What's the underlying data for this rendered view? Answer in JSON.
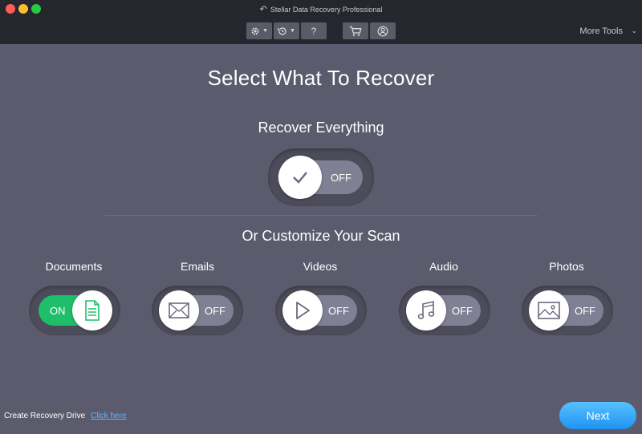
{
  "window": {
    "title": "Stellar Data Recovery Professional"
  },
  "toolbar": {
    "more_tools": "More Tools"
  },
  "main": {
    "title": "Select What To Recover",
    "recover_everything": {
      "label": "Recover Everything",
      "state": "OFF"
    },
    "customize_label": "Or Customize Your Scan",
    "categories": [
      {
        "label": "Documents",
        "state": "ON",
        "icon": "document-icon"
      },
      {
        "label": "Emails",
        "state": "OFF",
        "icon": "envelope-icon"
      },
      {
        "label": "Videos",
        "state": "OFF",
        "icon": "play-icon"
      },
      {
        "label": "Audio",
        "state": "OFF",
        "icon": "music-note-icon"
      },
      {
        "label": "Photos",
        "state": "OFF",
        "icon": "image-icon"
      }
    ]
  },
  "footer": {
    "create_drive_text": "Create Recovery Drive",
    "click_here": "Click here",
    "next_label": "Next"
  },
  "colors": {
    "background": "#5b5b6d",
    "titlebar": "#25262e",
    "toggle_on": "#1fbe6a",
    "toggle_off": "#808094",
    "next_button": "#2aa2f8",
    "link": "#5fb4ff"
  }
}
